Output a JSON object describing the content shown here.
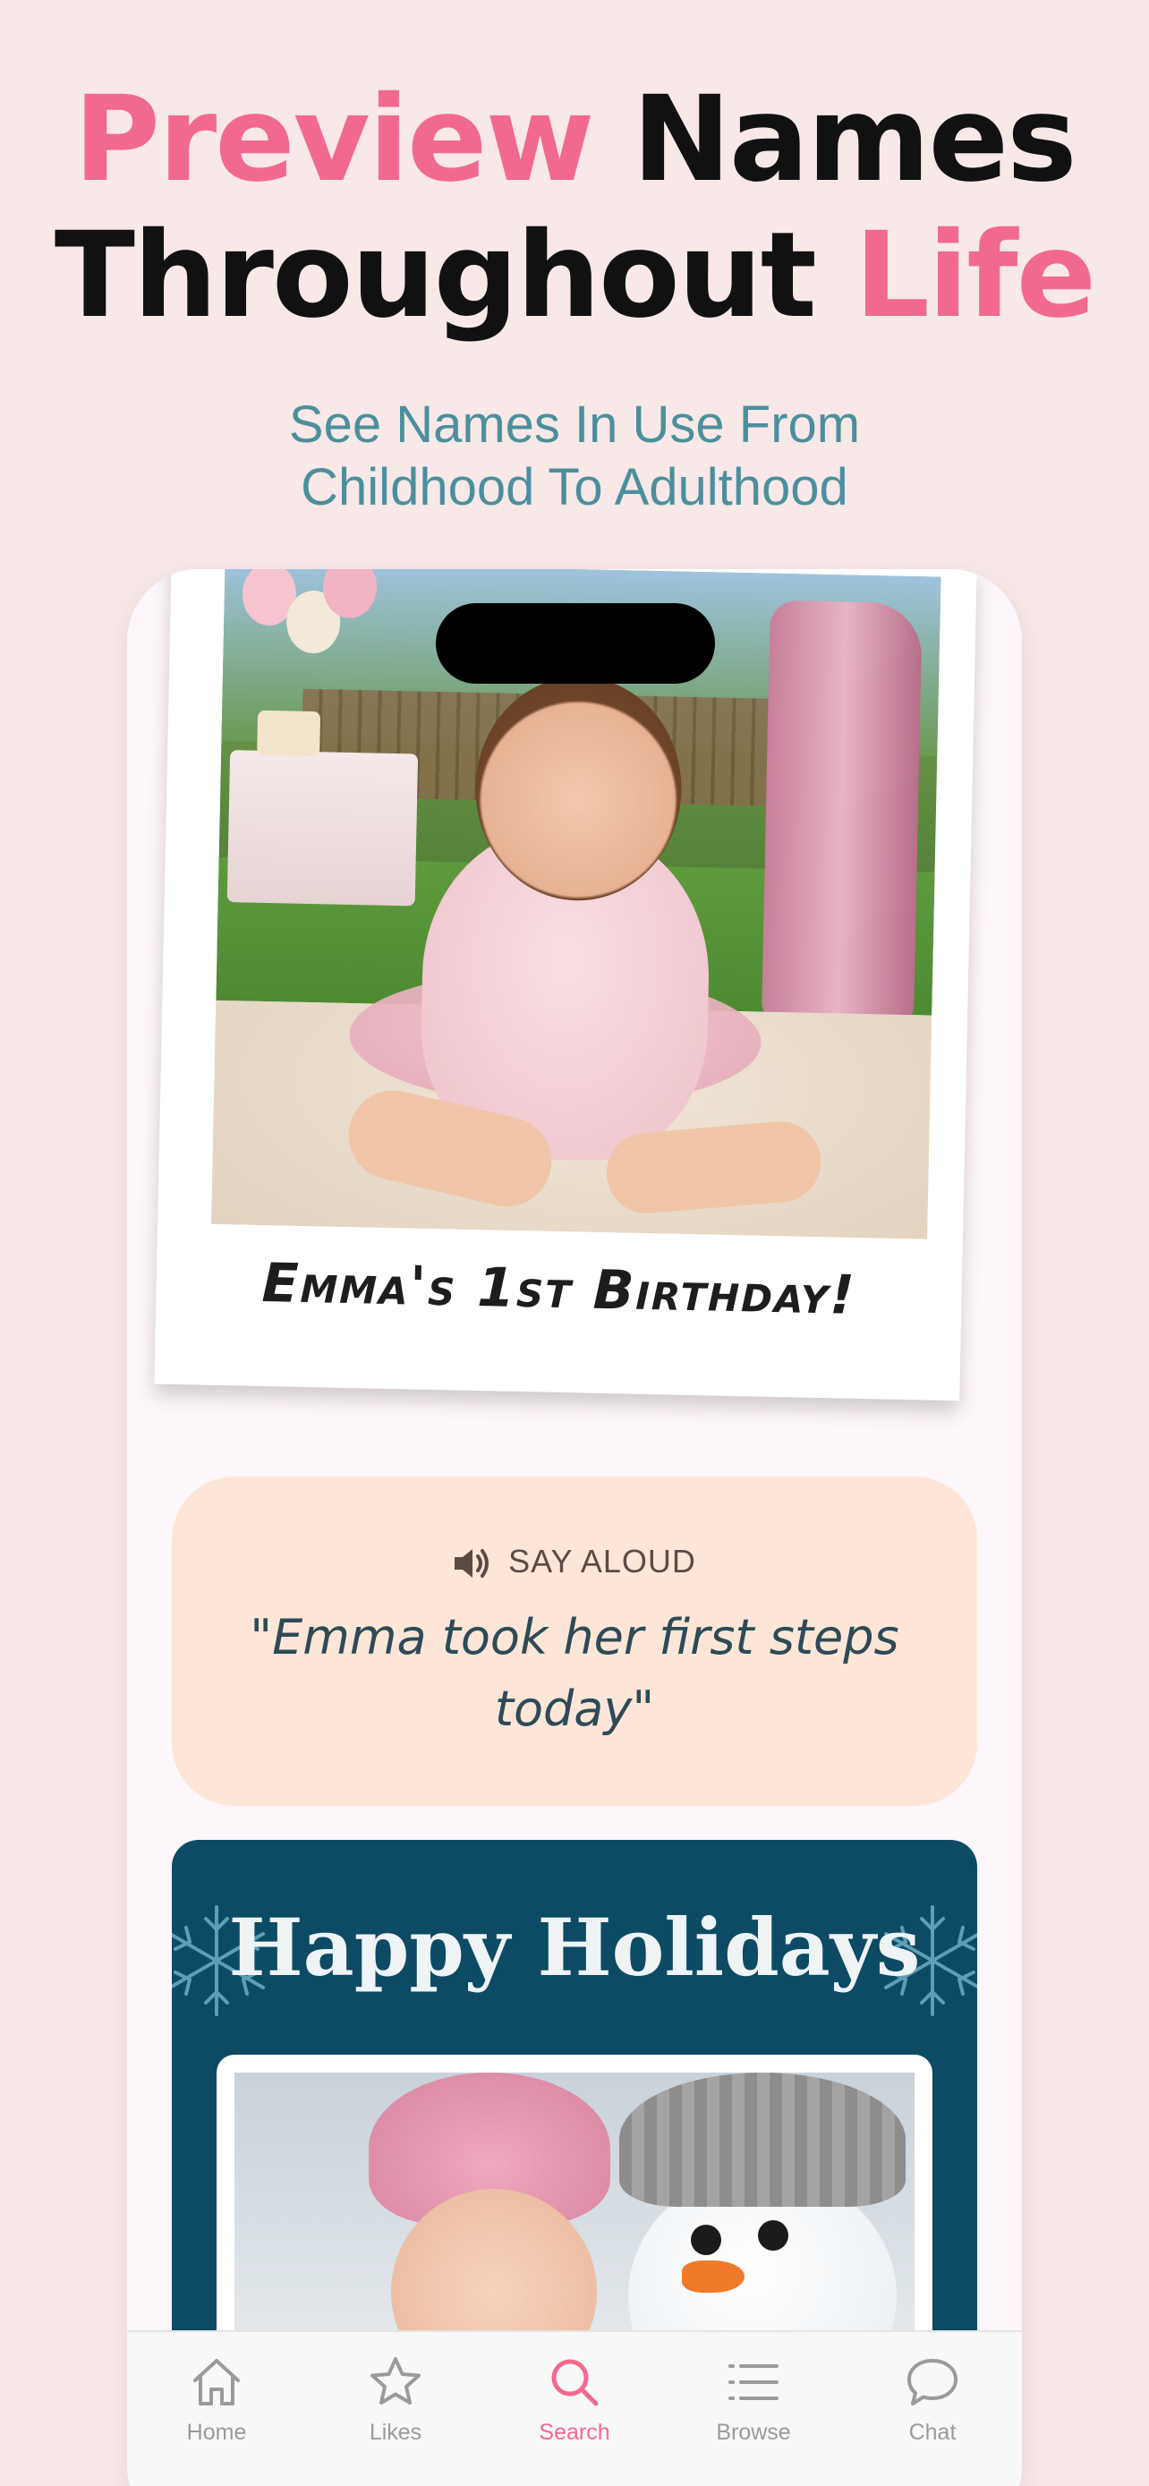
{
  "headline": {
    "line1_pink": "Preview",
    "line1_dark": "Names",
    "line2_dark": "Throughout",
    "line2_pink": "Life"
  },
  "subtitle": {
    "line1": "See Names In Use From",
    "line2": "Childhood To Adulthood"
  },
  "polaroid": {
    "caption": "Emma's 1st Birthday!"
  },
  "say_aloud": {
    "label": "SAY ALOUD",
    "icon": "speaker-icon",
    "quote_line1": "\"Emma took her first steps",
    "quote_line2": "today\""
  },
  "holiday_card": {
    "title": "Happy Holidays",
    "icon": "snowflake-icon"
  },
  "tabbar": {
    "tabs": [
      {
        "label": "Home",
        "icon": "home-icon"
      },
      {
        "label": "Likes",
        "icon": "star-icon"
      },
      {
        "label": "Search",
        "icon": "search-icon"
      },
      {
        "label": "Browse",
        "icon": "list-icon"
      },
      {
        "label": "Chat",
        "icon": "chat-bubble-icon"
      }
    ],
    "active": "Search"
  },
  "colors": {
    "accent_pink": "#f2698f",
    "teal_text": "#4b8f9c",
    "say_card_bg": "#fde6d8",
    "holiday_bg": "#0d4a63",
    "page_bg": "#f8e8e8"
  }
}
